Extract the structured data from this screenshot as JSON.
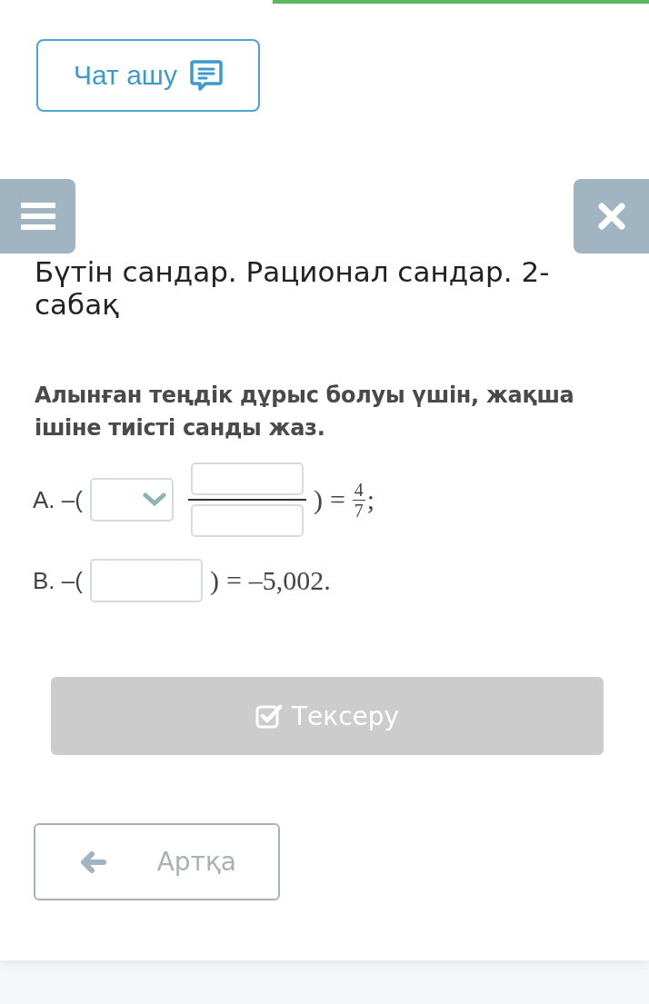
{
  "chat_button": {
    "label": "Чат ашу"
  },
  "lesson_title": "Бүтін сандар. Рационал сандар. 2-сабақ",
  "question": "Алынған теңдік дұрыс болуы үшін, жақша ішіне тиісті санды жаз.",
  "items": [
    {
      "kind": "fraction",
      "prefix": "A. –(",
      "close": ")",
      "equals": "=",
      "numerator": "4",
      "denominator": "7",
      "end": ";"
    },
    {
      "kind": "single",
      "prefix": "B. –(",
      "close": ")",
      "equals": "=",
      "result": "–5,002."
    }
  ],
  "check_button": {
    "label": "Тексеру",
    "disabled": true
  },
  "back_button": {
    "label": "Артқа"
  }
}
